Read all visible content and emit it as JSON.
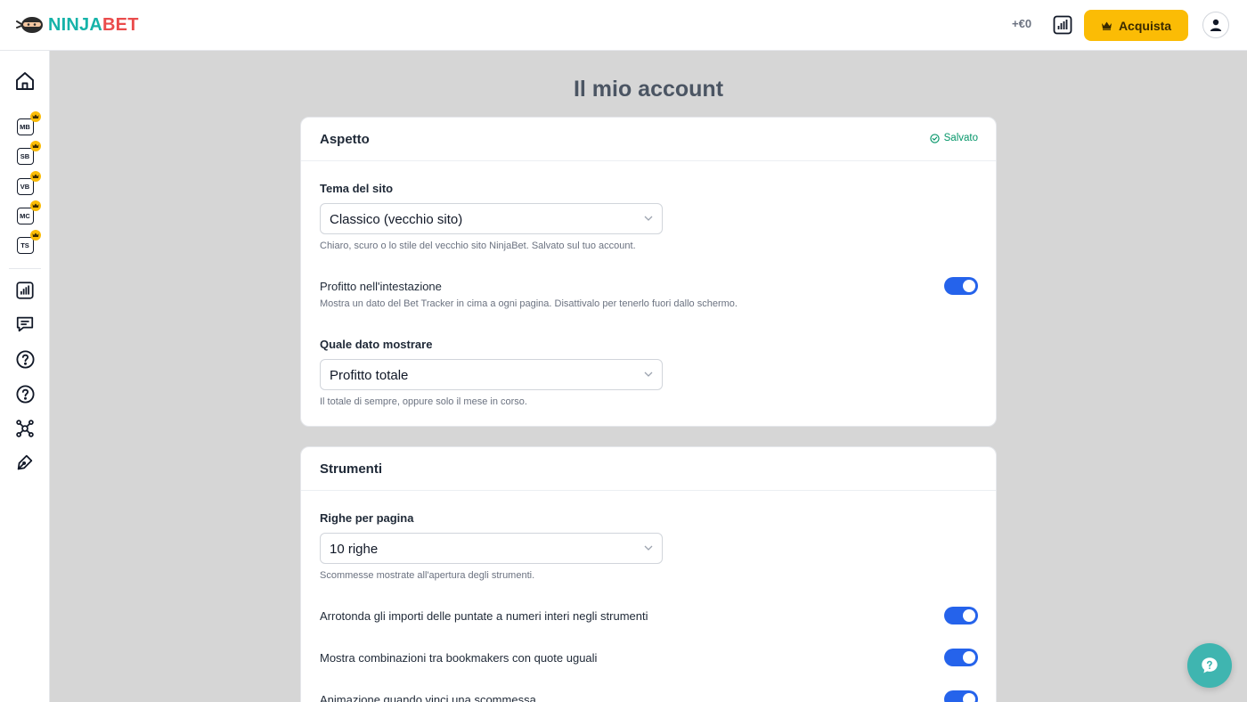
{
  "header": {
    "brand_part1": "NINJA",
    "brand_part2": "BET",
    "profit": "+€0",
    "buy_label": "Acquista"
  },
  "sidebar": {
    "tools": [
      {
        "label": "MB"
      },
      {
        "label": "SB"
      },
      {
        "label": "VB"
      },
      {
        "label": "MC"
      },
      {
        "label": "TS"
      }
    ]
  },
  "page": {
    "title": "Il mio account"
  },
  "appearance": {
    "title": "Aspetto",
    "saved_label": "Salvato",
    "theme_label": "Tema del sito",
    "theme_value": "Classico (vecchio sito)",
    "theme_help": "Chiaro, scuro o lo stile del vecchio sito NinjaBet. Salvato sul tuo account.",
    "header_profit_label": "Profitto nell'intestazione",
    "header_profit_help": "Mostra un dato del Bet Tracker in cima a ogni pagina. Disattivalo per tenerlo fuori dallo schermo.",
    "header_profit_on": true,
    "data_label": "Quale dato mostrare",
    "data_value": "Profitto totale",
    "data_help": "Il totale di sempre, oppure solo il mese in corso."
  },
  "tools_section": {
    "title": "Strumenti",
    "rows_label": "Righe per pagina",
    "rows_value": "10 righe",
    "rows_help": "Scommesse mostrate all'apertura degli strumenti.",
    "round_label": "Arrotonda gli importi delle puntate a numeri interi negli strumenti",
    "round_on": true,
    "same_odds_label": "Mostra combinazioni tra bookmakers con quote uguali",
    "same_odds_on": true,
    "win_anim_label": "Animazione quando vinci una scommessa",
    "win_anim_on": true
  },
  "colors": {
    "accent": "#2563eb",
    "buy": "#fbbc05",
    "brand_teal": "#16b3a9",
    "brand_red": "#ea4c4c",
    "saved": "#059669",
    "chat": "#3fb5b0"
  }
}
